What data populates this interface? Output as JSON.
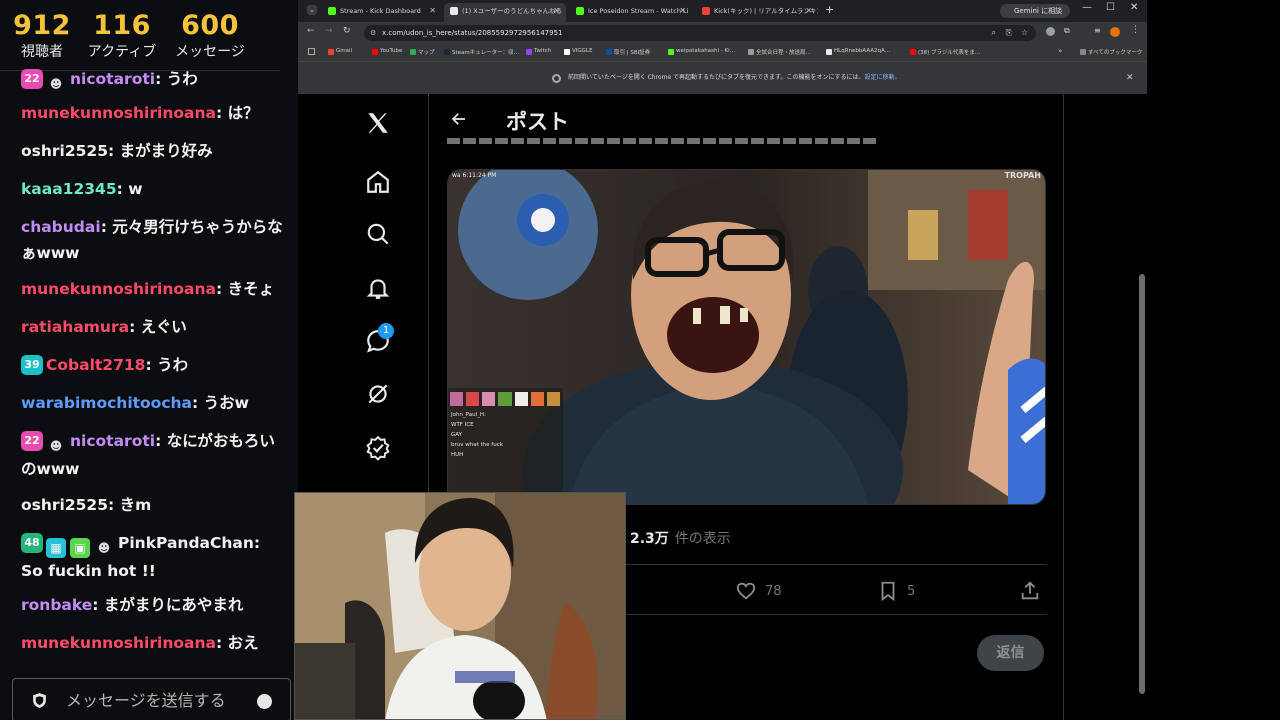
{
  "stats": [
    {
      "value": "912",
      "label": "視聴者"
    },
    {
      "value": "116",
      "label": "アクティブ"
    },
    {
      "value": "600",
      "label": "メッセージ"
    }
  ],
  "chat": {
    "messages": [
      {
        "user": "nicotaroti",
        "text": "うわ",
        "user_color": "#c38bf5",
        "badge": "22",
        "badge_color": "#e94bb1"
      },
      {
        "user": "munekunnoshirinoana",
        "text": "は？",
        "user_color": "#ff4a6a"
      },
      {
        "user": "oshri2525",
        "text": "まがまり好み",
        "user_color": "#f0f0f0"
      },
      {
        "user": "kaaa12345",
        "text": "w",
        "user_color": "#6ee7c7"
      },
      {
        "user": "chabudai",
        "text": "元々男行けちゃうからなぁwww",
        "user_color": "#c38bf5"
      },
      {
        "user": "munekunnoshirinoana",
        "text": "きそょ",
        "user_color": "#ff4a6a"
      },
      {
        "user": "ratiahamura",
        "text": "えぐい",
        "user_color": "#ff4a6a"
      },
      {
        "user": "Cobalt2718",
        "text": "うわ",
        "user_color": "#ff4a6a",
        "badge": "39",
        "badge_color": "#1fbfc9"
      },
      {
        "user": "warabimochitoocha",
        "text": "うおw",
        "user_color": "#5e9bff"
      },
      {
        "user": "nicotaroti",
        "text": "なにがおもろいのwww",
        "user_color": "#c38bf5",
        "badge": "22",
        "badge_color": "#e94bb1"
      },
      {
        "user": "oshri2525",
        "text": "きm",
        "user_color": "#f0f0f0"
      },
      {
        "user": "PinkPandaChan",
        "text": "So fuckin hot !!",
        "user_color": "#f0f0f0",
        "badge": "48",
        "badge_color": "#25b57a"
      },
      {
        "user": "ronbake",
        "text": "まがまりにあやまれ",
        "user_color": "#c38bf5"
      },
      {
        "user": "munekunnoshirinoana",
        "text": "おえ",
        "user_color": "#ff4a6a"
      }
    ],
    "separator": ": ",
    "input_placeholder": "メッセージを送信する"
  },
  "browser": {
    "tabs": [
      {
        "title": "Stream - Kick Dashboard",
        "favicon": "#53fc18"
      },
      {
        "title": "(1) Xユーザーのうどんちゃんねる",
        "favicon": "#e7e9ea"
      },
      {
        "title": "Ice Poseidon Stream - Watch Li",
        "favicon": "#53fc18"
      },
      {
        "title": "Kick(キック) | リアルタイムランキング",
        "favicon": "#ea4335"
      }
    ],
    "new_tab": "+",
    "gemini_label": "Gemini に相談",
    "url": "x.com/udon_is_here/status/2085592972956147951",
    "bookmarks": [
      {
        "label": "Gmail",
        "color": "#ea4335"
      },
      {
        "label": "YouTube",
        "color": "#ff0000"
      },
      {
        "label": "マップ",
        "color": "#34a853"
      },
      {
        "label": "Steamキュレーター：収…",
        "color": "#1b2838"
      },
      {
        "label": "Twitch",
        "color": "#9146ff"
      },
      {
        "label": "VIGGLE",
        "color": "#ffffff"
      },
      {
        "label": "取引 | SBI証券",
        "color": "#0b4ea2"
      },
      {
        "label": "weipatakahashi - Ki…",
        "color": "#53fc18"
      },
      {
        "label": "全試合日程・放送局…",
        "color": "#999999"
      },
      {
        "label": "HLqRnebbAAA2qA…",
        "color": "#e7e9ea"
      },
      {
        "label": "(38) ブラジル代表をま…",
        "color": "#ff0000"
      }
    ],
    "all_bookmarks": "すべてのブックマーク",
    "infobar": {
      "text": "前回開いていたページを開く Chrome で再起動するたびにタブを復元できます。この機能をオンにするには、",
      "link": "設定に移動。"
    },
    "window_controls": {
      "minimize": "—",
      "maximize": "☐",
      "close": "✕"
    }
  },
  "x": {
    "title": "ポスト",
    "notification_count": "1",
    "views_value": "2.3万",
    "views_label": "件の表示",
    "likes": "78",
    "bookmarks": "5",
    "reply_button": "返信",
    "photo_timestamp": "wa 6:11:24 PM",
    "photo_watermark": "TROPAH",
    "overlay_chat": [
      "John_Paul_H:",
      "WTF ICE",
      "GAY",
      "bruv what the fuck",
      "HUH"
    ]
  }
}
